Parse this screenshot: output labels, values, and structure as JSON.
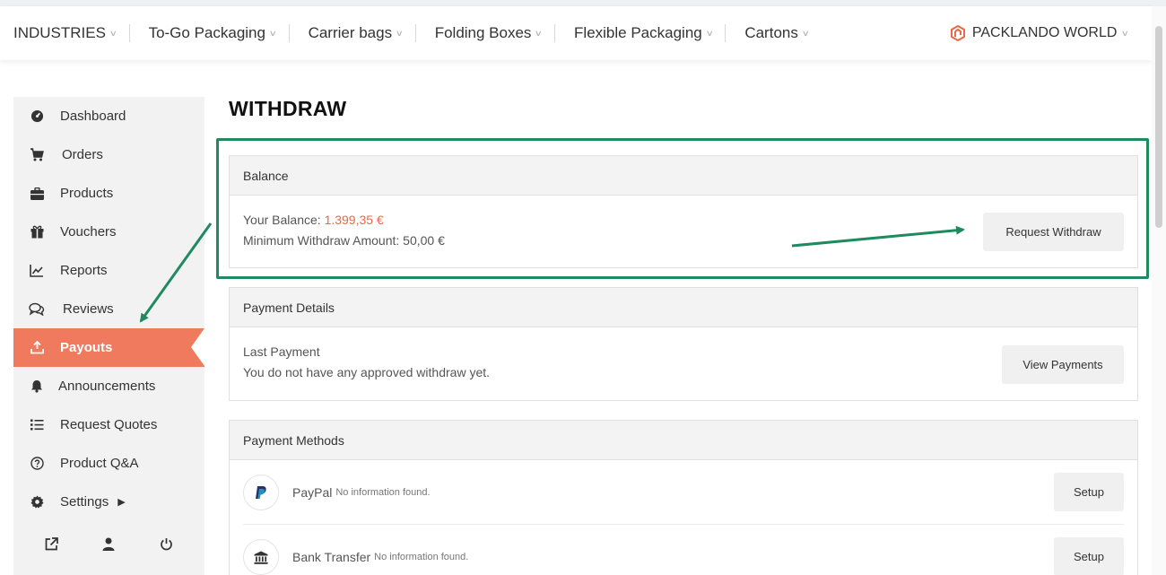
{
  "nav": {
    "items": [
      "INDUSTRIES",
      "To-Go Packaging",
      "Carrier bags",
      "Folding Boxes",
      "Flexible Packaging",
      "Cartons"
    ],
    "brand": "PACKLANDO WORLD"
  },
  "sidebar": {
    "items": [
      {
        "label": "Dashboard",
        "icon": "gauge-icon"
      },
      {
        "label": "Orders",
        "icon": "cart-icon"
      },
      {
        "label": "Products",
        "icon": "briefcase-icon"
      },
      {
        "label": "Vouchers",
        "icon": "gift-icon"
      },
      {
        "label": "Reports",
        "icon": "chart-line-icon"
      },
      {
        "label": "Reviews",
        "icon": "comments-icon"
      },
      {
        "label": "Payouts",
        "icon": "upload-icon",
        "active": true
      },
      {
        "label": "Announcements",
        "icon": "bell-icon"
      },
      {
        "label": "Request Quotes",
        "icon": "list-icon"
      },
      {
        "label": "Product Q&A",
        "icon": "question-icon"
      },
      {
        "label": "Settings",
        "icon": "gear-icon"
      }
    ],
    "bottom_icons": [
      "external-link-icon",
      "user-icon",
      "power-icon"
    ]
  },
  "page": {
    "title": "WITHDRAW"
  },
  "balance": {
    "heading": "Balance",
    "your_balance_label": "Your Balance:",
    "your_balance_value": "1.399,35 €",
    "minimum_line": "Minimum Withdraw Amount: 50,00 €",
    "button": "Request Withdraw"
  },
  "payment_details": {
    "heading": "Payment Details",
    "last_payment_label": "Last Payment",
    "last_payment_text": "You do not have any approved withdraw yet.",
    "button": "View Payments"
  },
  "payment_methods": {
    "heading": "Payment Methods",
    "methods": [
      {
        "name": "PayPal",
        "note": "No information found.",
        "button": "Setup",
        "icon": "paypal-icon"
      },
      {
        "name": "Bank Transfer",
        "note": "No information found.",
        "button": "Setup",
        "icon": "bank-icon"
      }
    ]
  },
  "colors": {
    "accent": "#f07a5e",
    "balance_value": "#e8684a",
    "annotation": "#1f8a5f"
  }
}
